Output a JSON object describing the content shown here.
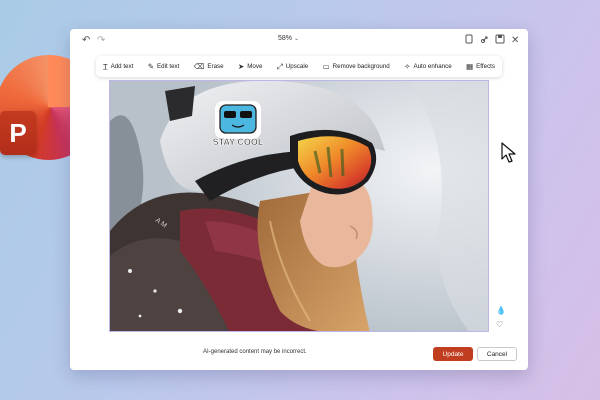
{
  "brand": {
    "logo_letter": "P",
    "accent": "#c13d20"
  },
  "window": {
    "zoom_label": "58%",
    "title_icons": [
      "undo-icon",
      "redo-icon",
      "copy-icon",
      "share-icon",
      "save-icon",
      "close-icon"
    ]
  },
  "toolbar": {
    "items": [
      {
        "label": "Add text",
        "icon": "add-text-icon"
      },
      {
        "label": "Edit text",
        "icon": "edit-text-icon"
      },
      {
        "label": "Erase",
        "icon": "eraser-icon"
      },
      {
        "label": "Move",
        "icon": "move-icon"
      },
      {
        "label": "Upscale",
        "icon": "upscale-icon"
      },
      {
        "label": "Remove background",
        "icon": "remove-background-icon"
      },
      {
        "label": "Auto enhance",
        "icon": "sparkle-icon"
      },
      {
        "label": "Effects",
        "icon": "effects-icon"
      }
    ]
  },
  "image": {
    "sticker_text": "STAY COOL",
    "goggle_strap_text": "A M"
  },
  "footer": {
    "note": "AI-generated content may be incorrect.",
    "update_label": "Update",
    "cancel_label": "Cancel"
  }
}
